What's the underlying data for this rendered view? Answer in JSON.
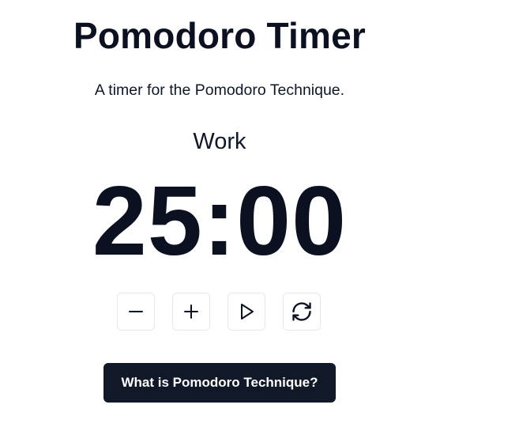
{
  "header": {
    "title": "Pomodoro Timer",
    "subtitle": "A timer for the Pomodoro Technique."
  },
  "timer": {
    "mode": "Work",
    "time": "25:00"
  },
  "controls": {
    "decrease_icon": "minus-icon",
    "increase_icon": "plus-icon",
    "start_icon": "play-icon",
    "reset_icon": "refresh-icon"
  },
  "info_button": {
    "label": "What is Pomodoro Technique?"
  },
  "colors": {
    "text": "#0b1120",
    "button_dark": "#111827",
    "control_border": "#e5e7eb"
  }
}
